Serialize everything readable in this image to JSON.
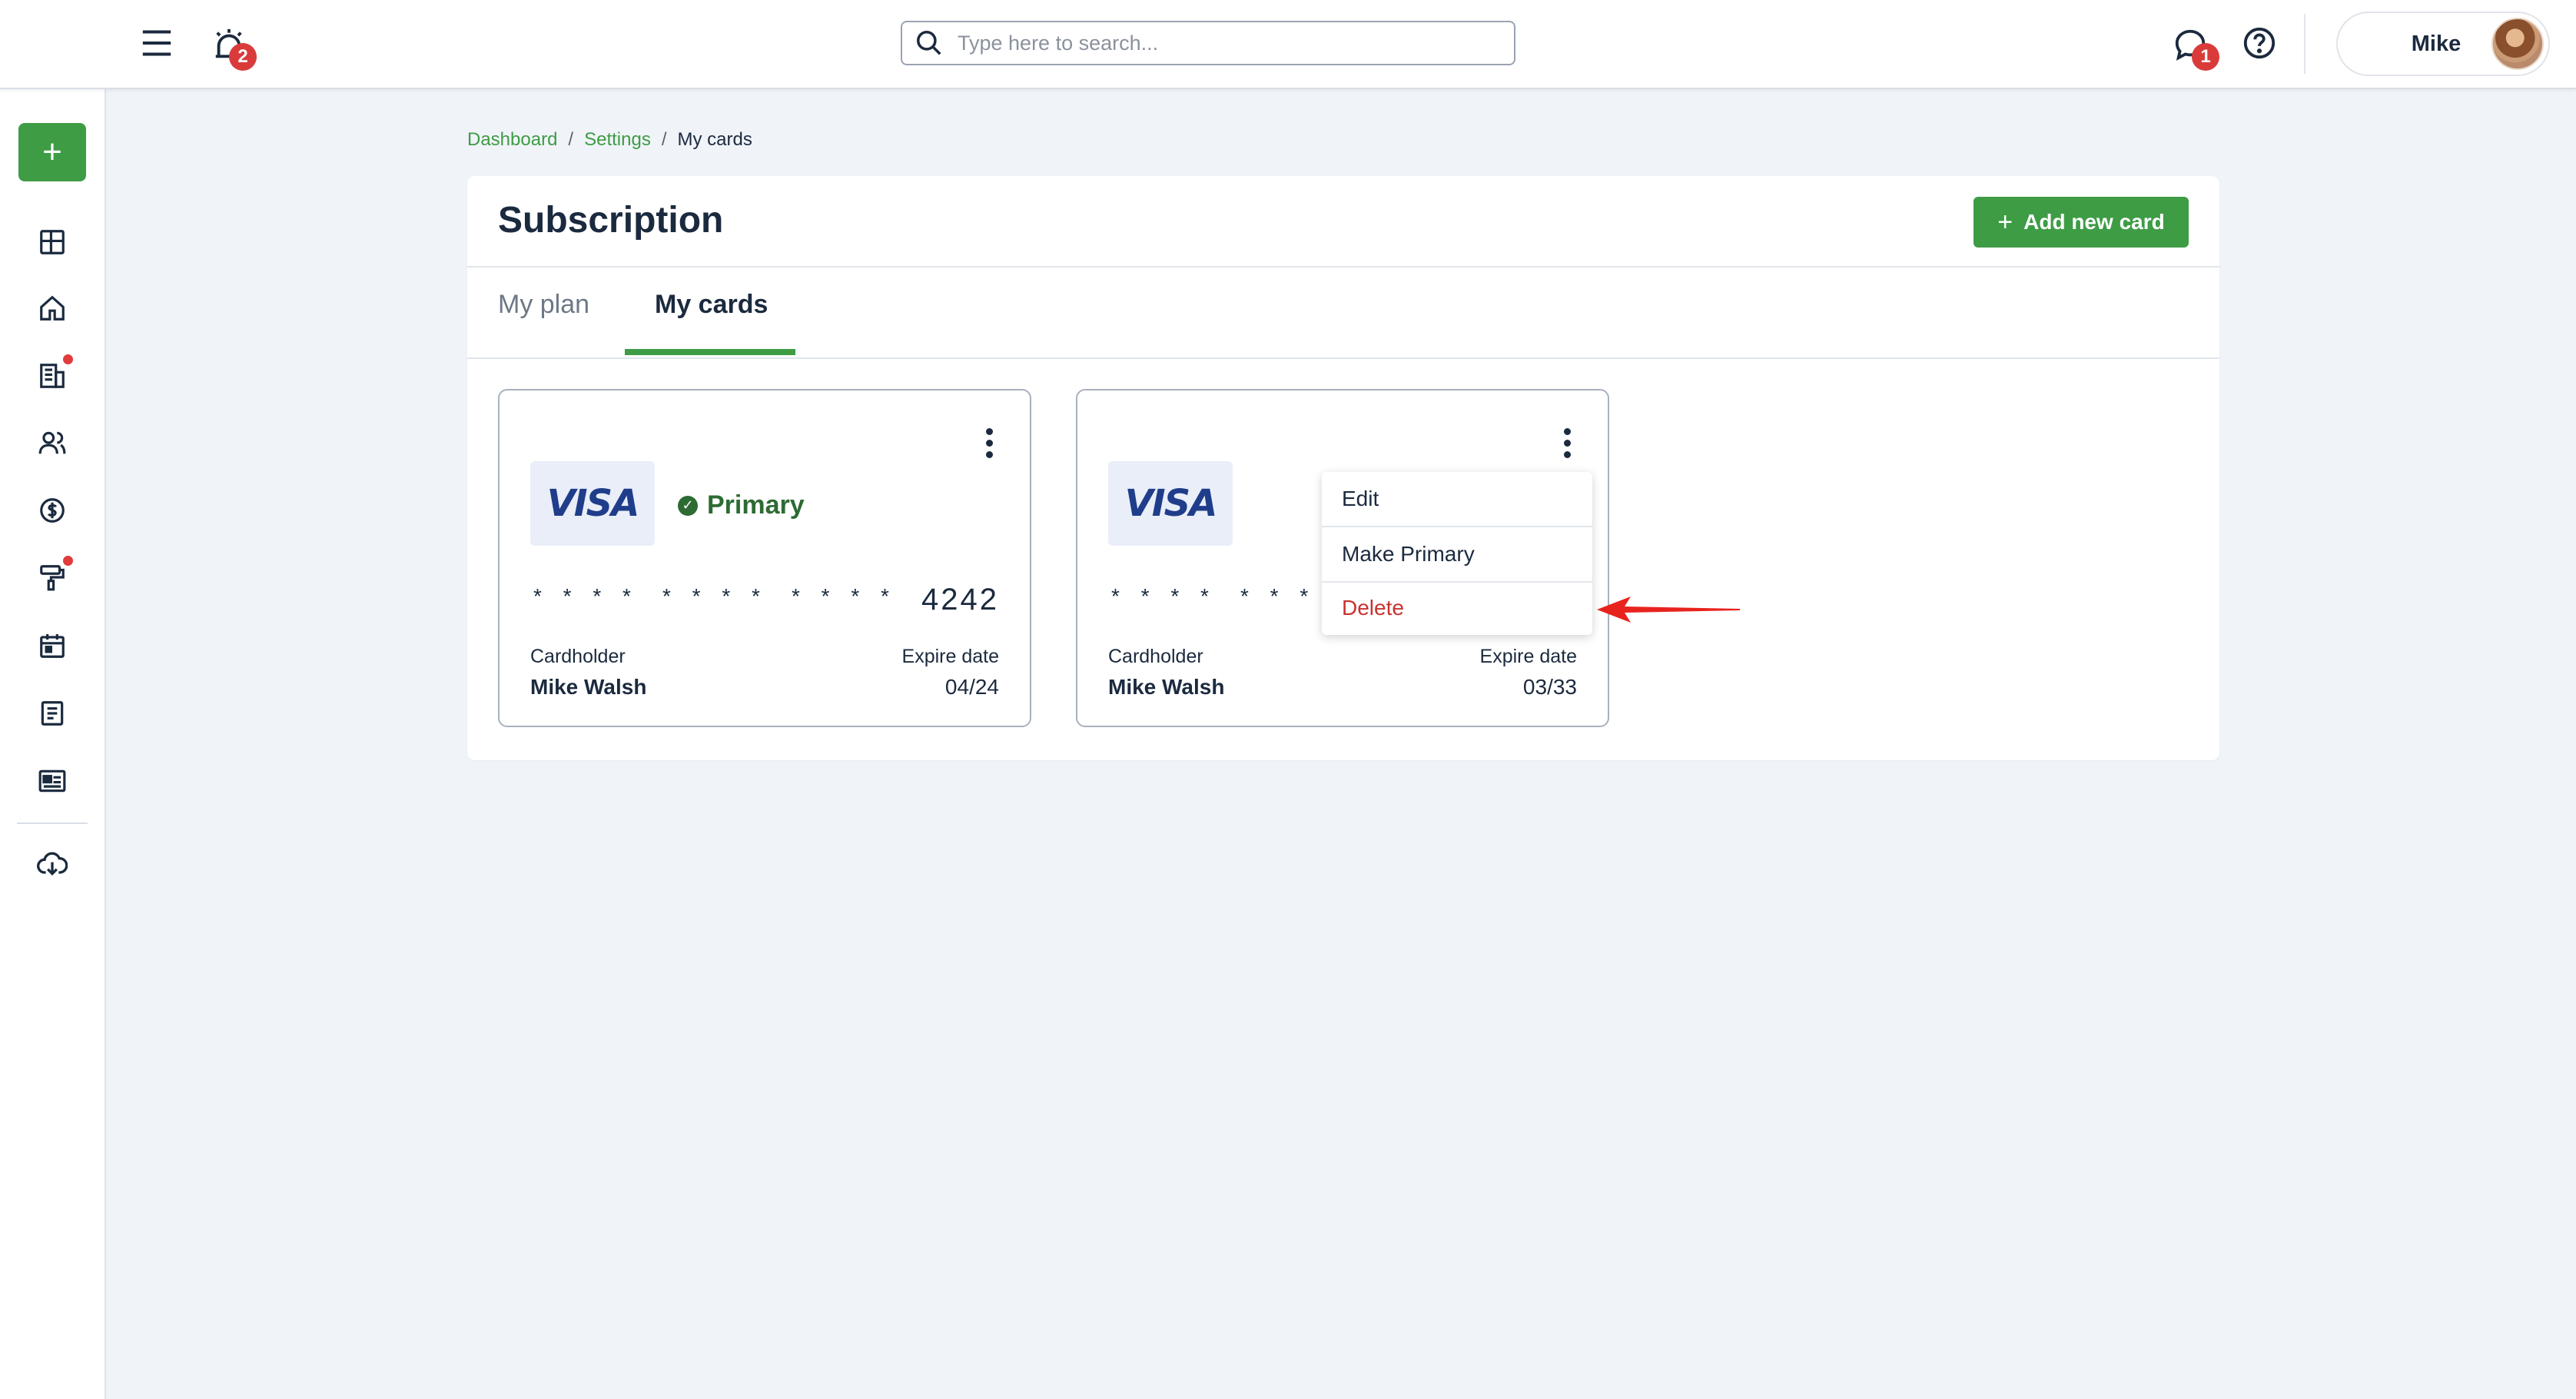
{
  "header": {
    "alerts_badge": "2",
    "messages_badge": "1",
    "search_placeholder": "Type here to search...",
    "user_name": "Mike"
  },
  "sidebar": {
    "add_label": "+",
    "items": [
      {
        "icon": "layout-grid-icon",
        "dot": false
      },
      {
        "icon": "home-icon",
        "dot": false
      },
      {
        "icon": "building-icon",
        "dot": true
      },
      {
        "icon": "users-icon",
        "dot": false
      },
      {
        "icon": "dollar-icon",
        "dot": false
      },
      {
        "icon": "paint-roller-icon",
        "dot": true
      },
      {
        "icon": "calendar-icon",
        "dot": false
      },
      {
        "icon": "document-icon",
        "dot": false
      },
      {
        "icon": "id-card-icon",
        "dot": false
      },
      {
        "icon": "cloud-download-icon",
        "dot": false
      }
    ]
  },
  "breadcrumb": {
    "items": [
      "Dashboard",
      "Settings",
      "My cards"
    ],
    "separator": "/"
  },
  "page": {
    "title": "Subscription",
    "add_card_label": "Add new card",
    "tabs": [
      {
        "label": "My plan",
        "active": false
      },
      {
        "label": "My cards",
        "active": true
      }
    ]
  },
  "cards": [
    {
      "brand": "VISA",
      "primary_label": "Primary",
      "masked": [
        "* * * *",
        "* * * *",
        "* * * *"
      ],
      "last4": "4242",
      "cardholder_label": "Cardholder",
      "cardholder": "Mike Walsh",
      "expire_label": "Expire date",
      "expire": "04/24"
    },
    {
      "brand": "VISA",
      "masked": [
        "* * * *",
        "* * * *"
      ],
      "cardholder_label": "Cardholder",
      "cardholder": "Mike Walsh",
      "expire_label": "Expire date",
      "expire": "03/33"
    }
  ],
  "card_menu": {
    "items": [
      "Edit",
      "Make Primary",
      "Delete"
    ]
  },
  "colors": {
    "accent_green": "#3e9c45",
    "danger_red": "#c8332f",
    "annotation_arrow": "#e8231e"
  }
}
